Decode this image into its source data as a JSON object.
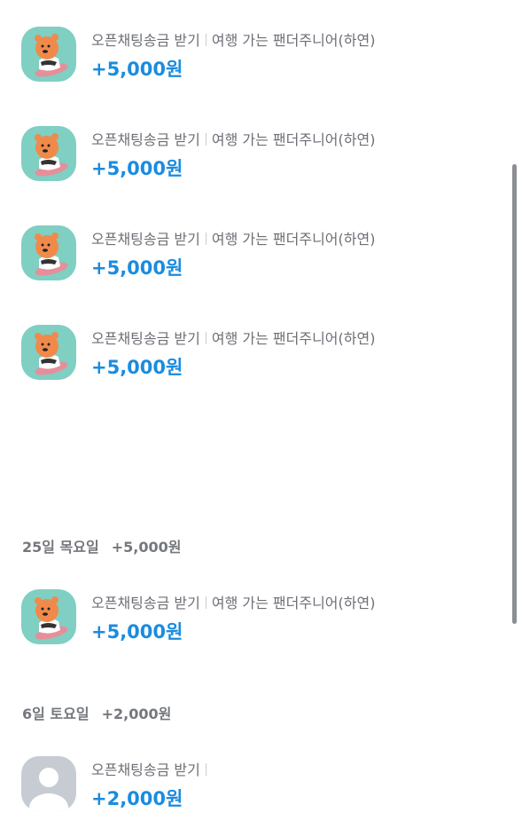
{
  "transactions_24": [
    {
      "title": "오픈채팅송금 받기",
      "sender": "여행 가는 팬더주니어(하연)",
      "amount": "+5,000원",
      "avatar": "panda-junior-avatar"
    },
    {
      "title": "오픈채팅송금 받기",
      "sender": "여행 가는 팬더주니어(하연)",
      "amount": "+5,000원",
      "avatar": "panda-junior-avatar"
    },
    {
      "title": "오픈채팅송금 받기",
      "sender": "여행 가는 팬더주니어(하연)",
      "amount": "+5,000원",
      "avatar": "panda-junior-avatar"
    },
    {
      "title": "오픈채팅송금 받기",
      "sender": "여행 가는 팬더주니어(하연)",
      "amount": "+5,000원",
      "avatar": "panda-junior-avatar"
    }
  ],
  "day_25": {
    "label": "25일 목요일",
    "total": "+5,000원",
    "transactions": [
      {
        "title": "오픈채팅송금 받기",
        "sender": "여행 가는 팬더주니어(하연)",
        "amount": "+5,000원",
        "avatar": "panda-junior-avatar"
      }
    ]
  },
  "day_6": {
    "label": "6일 토요일",
    "total": "+2,000원",
    "transactions": [
      {
        "title": "오픈채팅송금 받기",
        "sender": "",
        "amount": "+2,000원",
        "avatar": "default-profile-avatar"
      }
    ]
  },
  "colors": {
    "amount": "#1a8ce0",
    "avatar_bg": "#7fcfc3",
    "default_avatar_bg": "#c7ccd3"
  }
}
